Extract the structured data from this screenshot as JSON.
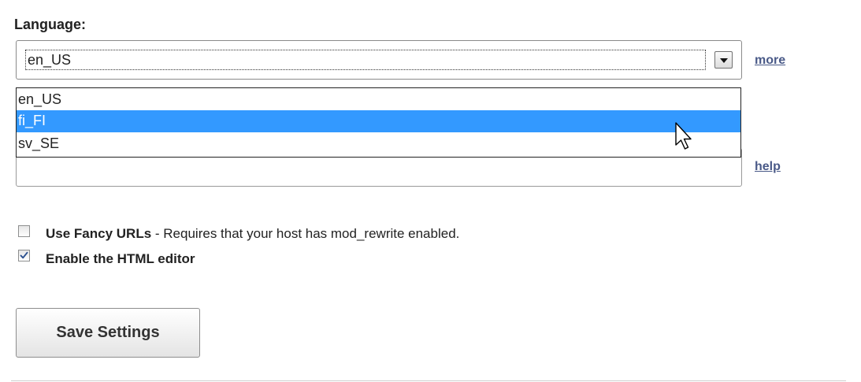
{
  "language": {
    "label": "Language:",
    "selected": "en_US",
    "options": [
      "en_US",
      "fi_FI",
      "sv_SE"
    ],
    "highlighted_option": "fi_FI"
  },
  "links": {
    "more": "more",
    "help": "help"
  },
  "options": {
    "fancy_urls": {
      "checked": false,
      "label_bold": "Use Fancy URLs",
      "label_rest": " - Requires that your host has mod_rewrite enabled."
    },
    "html_editor": {
      "checked": true,
      "label_bold": "Enable the HTML editor"
    }
  },
  "save_button": {
    "label": "Save Settings"
  },
  "colors": {
    "link": "#4a5a88",
    "highlight": "#3399ff",
    "check": "#2a4f8f"
  }
}
